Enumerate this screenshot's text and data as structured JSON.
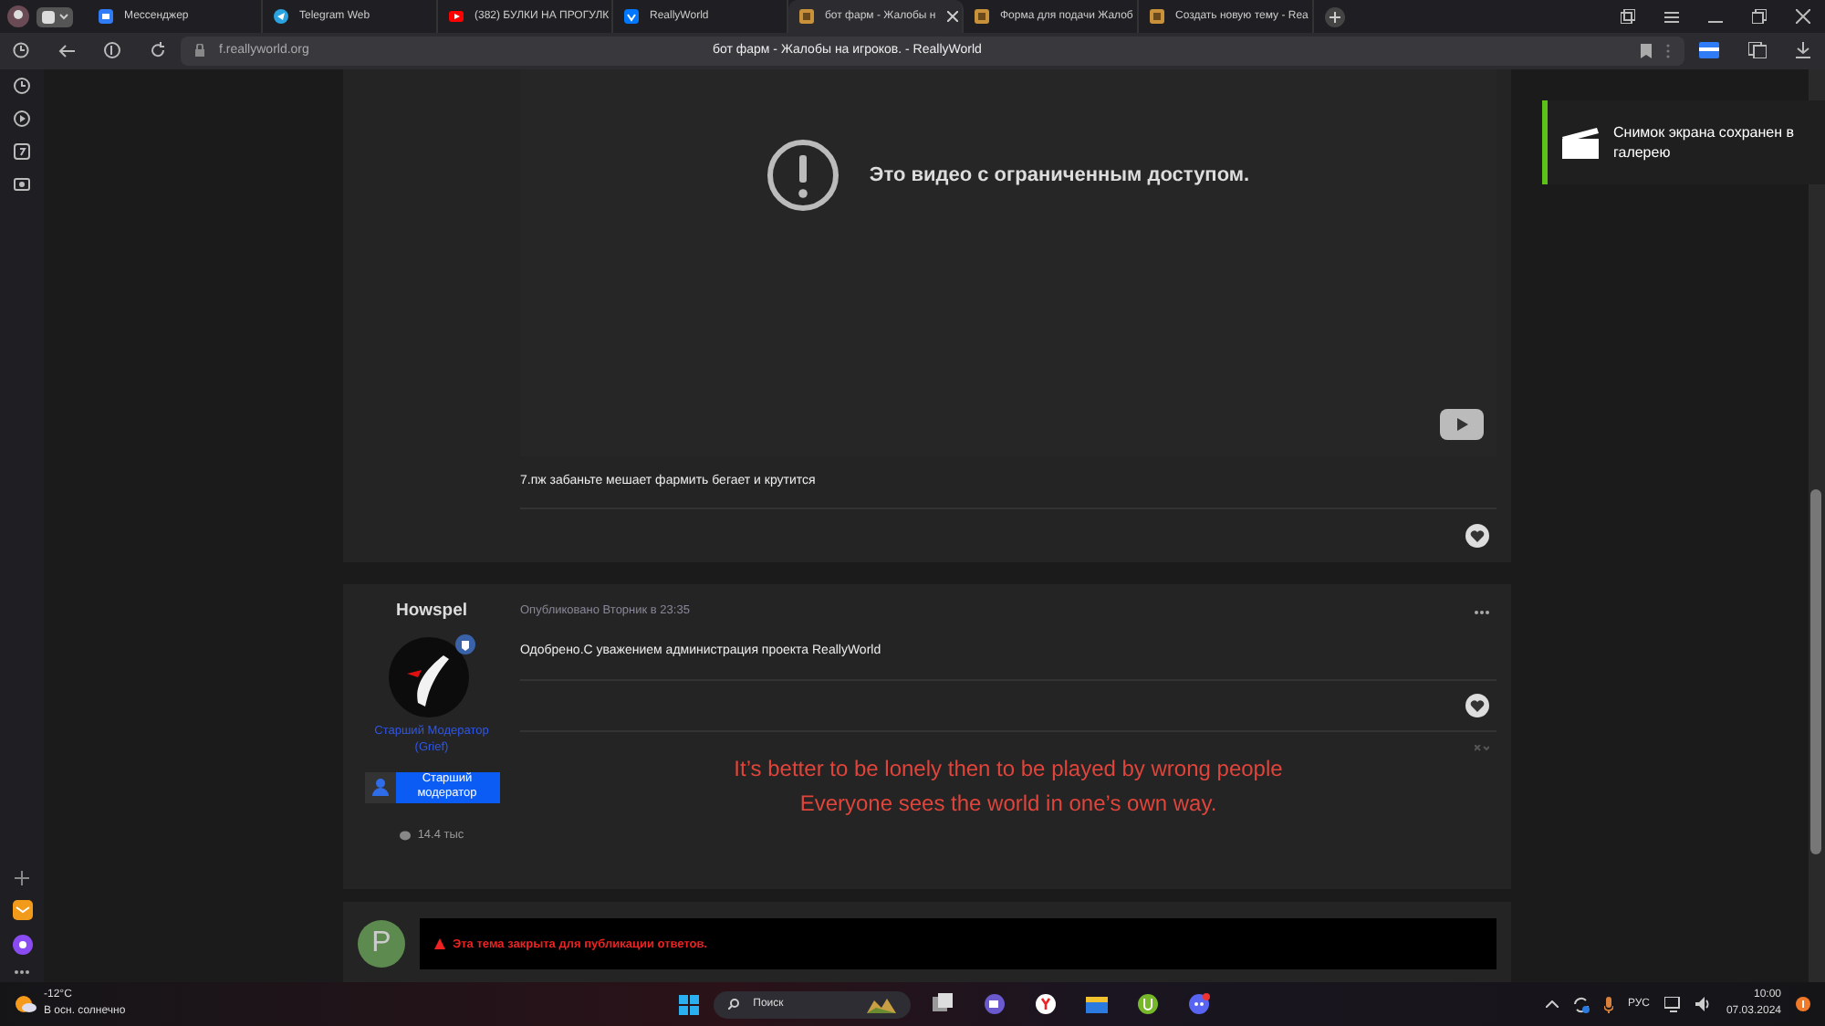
{
  "browser": {
    "tabs": [
      {
        "label": "Мессенджер",
        "kind": "messenger",
        "selected": false
      },
      {
        "label": "Telegram Web",
        "kind": "telegram",
        "selected": false
      },
      {
        "label": "(382) БУЛКИ НА ПРОГУЛК",
        "kind": "youtube",
        "selected": false
      },
      {
        "label": "ReallyWorld",
        "kind": "vk",
        "selected": false
      },
      {
        "label": "бот фарм - Жалобы н",
        "kind": "site",
        "selected": true
      },
      {
        "label": "Форма для подачи Жалоб",
        "kind": "site",
        "selected": false
      },
      {
        "label": "Создать новую тему - Rea",
        "kind": "site",
        "selected": false
      }
    ],
    "address": "f.reallyworld.org",
    "page_title": "бот фарм - Жалобы на игроков. - ReallyWorld"
  },
  "video": {
    "message": "Это видео с ограниченным доступом."
  },
  "posts": [
    {
      "text": "7.пж забаньте мешает фармить бегает и крутится"
    },
    {
      "author": "Howspel",
      "date": "Опубликовано Вторник в 23:35",
      "text": "Одобрено.С уважением администрация проекта ReallyWorld",
      "role": "Старший Модератор (Grief)",
      "badge": "Старший модератор",
      "count": "14.4 тыс",
      "signature": [
        "It’s better to be lonely then to be played by wrong people",
        "Everyone sees the world in one’s own way."
      ]
    }
  ],
  "reply": {
    "avatar": "P",
    "notice": "Эта тема закрыта для публикации ответов."
  },
  "notification": {
    "text": "Снимок экрана сохранен в галерею"
  },
  "taskbar": {
    "temperature": "-12°C",
    "weather": "В осн. солнечно",
    "search": "Поиск",
    "language": "РУС",
    "time": "10:00",
    "date": "07.03.2024"
  }
}
